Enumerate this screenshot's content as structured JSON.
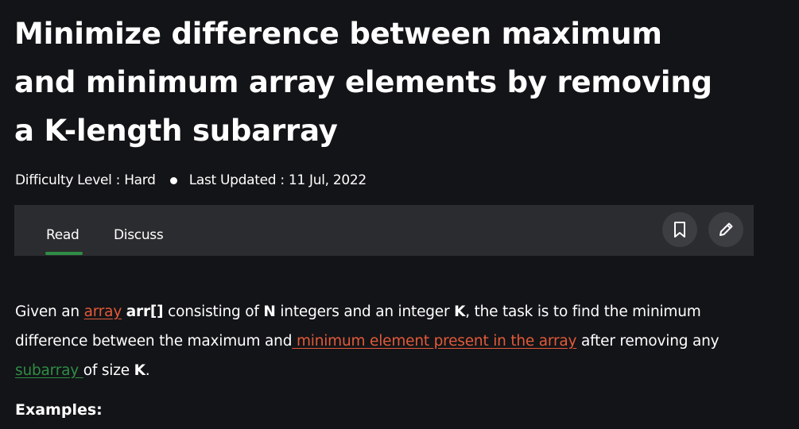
{
  "article": {
    "title": "Minimize difference between maximum and minimum array elements by removing a K-length subarray",
    "difficulty": "Difficulty Level : Hard",
    "last_updated": "Last Updated : 11 Jul, 2022"
  },
  "tabs": {
    "read": "Read",
    "discuss": "Discuss",
    "active": "Read"
  },
  "actions": {
    "bookmark_icon": "bookmark-icon",
    "edit_icon": "pencil-icon"
  },
  "body": {
    "p1_t1": "Given an ",
    "p1_link1": "array",
    "p1_t2": " ",
    "p1_b1": "arr[]",
    "p1_t3": " consisting of ",
    "p1_b2": "N",
    "p1_t4": " integers and an integer ",
    "p1_b3": "K",
    "p1_t5": ", the task is to find the minimum difference between the maximum and",
    "p1_link2": " minimum element present in the array",
    "p1_t6": " after removing any",
    "p1_link3": " subarray ",
    "p1_t7": "of size ",
    "p1_b4": "K",
    "p1_t8": "."
  },
  "examples_heading": "Examples:",
  "colors": {
    "background": "#131417",
    "tabbar": "#2b2c2f",
    "accent_green": "#2f8d46",
    "link_red": "#e25a3a"
  }
}
